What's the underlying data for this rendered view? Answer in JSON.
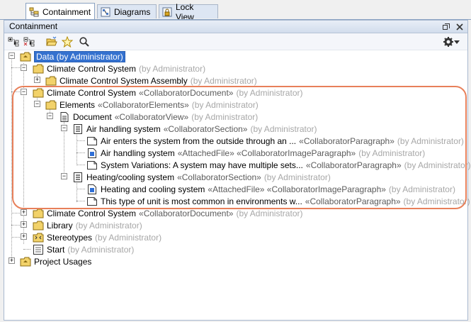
{
  "tabs": [
    {
      "label": "Containment",
      "icon": "containment-icon",
      "active": true
    },
    {
      "label": "Diagrams",
      "icon": "diagrams-icon",
      "active": false
    },
    {
      "label": "Lock View",
      "icon": "lock-view-icon",
      "active": false
    }
  ],
  "panel": {
    "title": "Containment"
  },
  "tree": {
    "root": {
      "label": "Data (by Administrator)"
    },
    "ccs1": {
      "label": "Climate Control System",
      "owner": "(by Administrator)"
    },
    "ccs_assembly": {
      "label": "Climate Control System Assembly",
      "owner": "(by Administrator)"
    },
    "ccs2": {
      "label": "Climate Control System",
      "stereo": "«CollaboratorDocument»",
      "owner": "(by Administrator)"
    },
    "elements": {
      "label": "Elements",
      "stereo": "«CollaboratorElements»",
      "owner": "(by Administrator)"
    },
    "document": {
      "label": "Document",
      "stereo": "«CollaboratorView»",
      "owner": "(by Administrator)"
    },
    "air_section": {
      "label": "Air handling system",
      "stereo": "«CollaboratorSection»",
      "owner": "(by Administrator)"
    },
    "air_p1": {
      "label": "Air enters the system from the outside through an ...",
      "stereo": "«CollaboratorParagraph»",
      "owner": "(by Administrator)"
    },
    "air_p2": {
      "label": "Air handling system",
      "stereo": "«AttachedFile» «CollaboratorImageParagraph»",
      "owner": "(by Administrator)"
    },
    "air_p3": {
      "label": "System Variations: A system may have multiple sets...",
      "stereo": "«CollaboratorParagraph»",
      "owner": "(by Administrator)"
    },
    "heat_section": {
      "label": "Heating/cooling system",
      "stereo": "«CollaboratorSection»",
      "owner": "(by Administrator)"
    },
    "heat_p1": {
      "label": "Heating and cooling system",
      "stereo": "«AttachedFile» «CollaboratorImageParagraph»",
      "owner": "(by Administrator)"
    },
    "heat_p2": {
      "label": "This type of unit is most common in environments w...",
      "stereo": "«CollaboratorParagraph»",
      "owner": "(by Administrator)"
    },
    "ccs3": {
      "label": "Climate Control System",
      "stereo": "«CollaboratorDocument»",
      "owner": "(by Administrator)"
    },
    "library": {
      "label": "Library",
      "owner": "(by Administrator)"
    },
    "stereotypes": {
      "label": "Stereotypes",
      "owner": "(by Administrator)"
    },
    "start": {
      "label": "Start",
      "owner": "(by Administrator)"
    },
    "usages": {
      "label": "Project Usages"
    }
  },
  "colors": {
    "selection": "#3471cf",
    "callout": "#e8805a",
    "owner_text": "#a7a7a7"
  }
}
